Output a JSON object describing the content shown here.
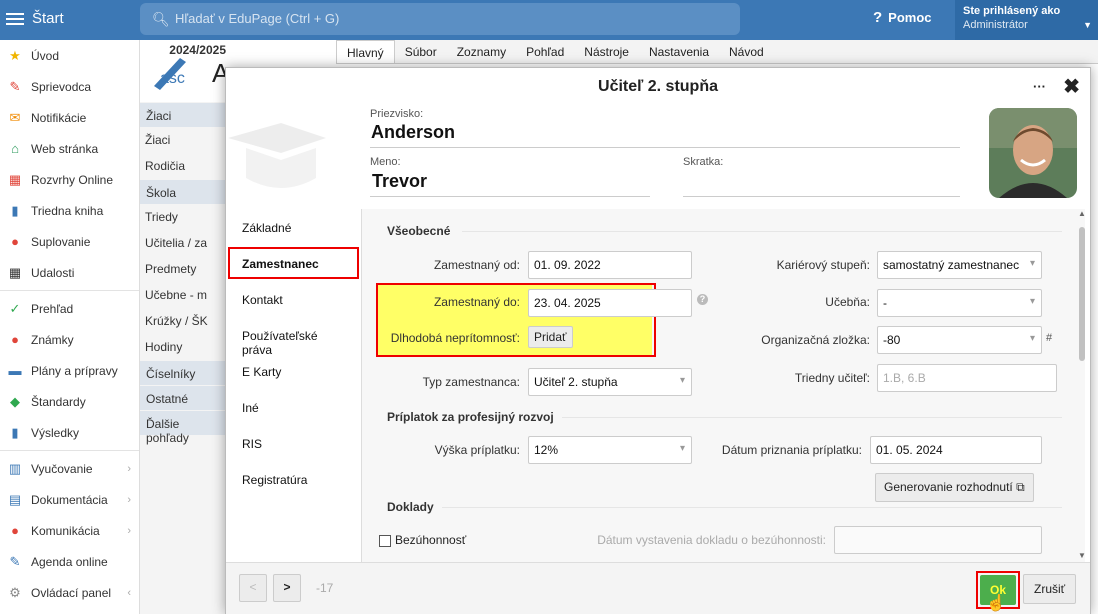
{
  "topbar": {
    "app_title": "Štart",
    "search_placeholder": "Hľadať v EduPage (Ctrl + G)",
    "help_label": "Pomoc",
    "user_line1": "Ste prihlásený ako",
    "user_line2": "Administrátor"
  },
  "sidebar": {
    "items": [
      {
        "label": "Úvod",
        "icon": "★",
        "color": "#f0b400"
      },
      {
        "label": "Sprievodca",
        "icon": "✎",
        "color": "#e0453a"
      },
      {
        "label": "Notifikácie",
        "icon": "✉",
        "color": "#f08a00"
      },
      {
        "label": "Web stránka",
        "icon": "⌂",
        "color": "#2e9b5e"
      },
      {
        "label": "Rozvrhy Online",
        "icon": "▦",
        "color": "#e0453a"
      },
      {
        "label": "Triedna kniha",
        "icon": "▮",
        "color": "#3c78b5"
      },
      {
        "label": "Suplovanie",
        "icon": "●",
        "color": "#e0453a"
      },
      {
        "label": "Udalosti",
        "icon": "▦",
        "color": "#333333"
      },
      {
        "label": "Prehľad",
        "icon": "✓",
        "color": "#2fa84f"
      },
      {
        "label": "Známky",
        "icon": "●",
        "color": "#e0453a"
      },
      {
        "label": "Plány a prípravy",
        "icon": "▬",
        "color": "#3c78b5"
      },
      {
        "label": "Štandardy",
        "icon": "◆",
        "color": "#2fa84f"
      },
      {
        "label": "Výsledky",
        "icon": "▮",
        "color": "#3c78b5"
      },
      {
        "label": "Vyučovanie",
        "icon": "▥",
        "color": "#3c78b5",
        "chev": "›"
      },
      {
        "label": "Dokumentácia",
        "icon": "▤",
        "color": "#3c78b5",
        "chev": "›"
      },
      {
        "label": "Komunikácia",
        "icon": "●",
        "color": "#e0453a",
        "chev": "›"
      },
      {
        "label": "Agenda online",
        "icon": "✎",
        "color": "#3c78b5"
      },
      {
        "label": "Ovládací panel",
        "icon": "⚙",
        "color": "#888888",
        "chev": "‹"
      }
    ]
  },
  "col2": {
    "year": "2024/2025",
    "logo_text": "asc",
    "logo_big": "A",
    "groups": [
      {
        "head": "Žiaci",
        "items": [
          "Žiaci",
          "Rodičia"
        ]
      },
      {
        "head": "Škola",
        "items": [
          "Triedy",
          "Učitelia / za",
          "Predmety",
          "Učebne - m",
          "Krúžky / ŠK",
          "Hodiny"
        ]
      },
      {
        "head": "Číselníky",
        "items": []
      },
      {
        "head": "Ostatné",
        "items": []
      },
      {
        "head": "Ďalšie pohľady",
        "items": []
      }
    ]
  },
  "menutabs": [
    "Hlavný",
    "Súbor",
    "Zoznamy",
    "Pohľad",
    "Nástroje",
    "Nastavenia",
    "Návod"
  ],
  "modal": {
    "title": "Učiteľ 2. stupňa",
    "dots": "···",
    "close": "✖",
    "surname_label": "Priezvisko:",
    "surname": "Anderson",
    "name_label": "Meno:",
    "name": "Trevor",
    "short_label": "Skratka:"
  },
  "leftnav": [
    "Základné",
    "Zamestnanec",
    "Kontakt",
    "Používateľské práva",
    "E Karty",
    "Iné",
    "RIS",
    "Registratúra"
  ],
  "content": {
    "section_general": "Všeobecné",
    "employed_from_label": "Zamestnaný od:",
    "employed_from": "01. 09. 2022",
    "employed_to_label": "Zamestnaný do:",
    "employed_to": "23. 04. 2025",
    "absence_label": "Dlhodobá neprítomnosť:",
    "absence_button": "Pridať",
    "employee_type_label": "Typ zamestnanca:",
    "employee_type": "Učiteľ 2. stupňa",
    "career_label": "Kariérový stupeň:",
    "career": "samostatný zamestnanec",
    "room_label": "Učebňa:",
    "room": "-",
    "org_label": "Organizačná zložka:",
    "org": "-80",
    "org_suffix": "#",
    "class_teacher_label": "Triedny učiteľ:",
    "class_teacher_placeholder": "1.B, 6.B",
    "section_bonus": "Príplatok za profesijný rozvoj",
    "bonus_label": "Výška príplatku:",
    "bonus": "12%",
    "bonus_date_label": "Dátum priznania príplatku:",
    "bonus_date": "01. 05. 2024",
    "generate_button": "Generovanie rozhodnutí",
    "section_docs": "Doklady",
    "integrity_label": "Bezúhonnosť",
    "integrity_date_label": "Dátum vystavenia dokladu o bezúhonnosti:"
  },
  "footer": {
    "prev": "<",
    "next": ">",
    "counter": "-17",
    "ok": "Ok",
    "cancel": "Zrušiť"
  }
}
